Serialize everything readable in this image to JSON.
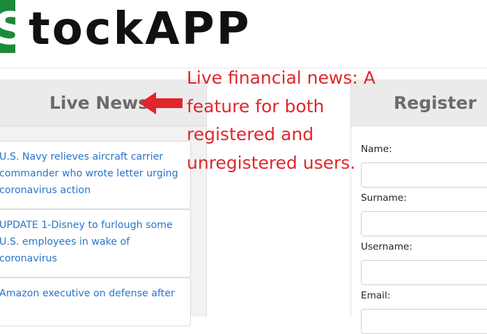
{
  "logo": {
    "text_s": "S",
    "text_rest": "tockAPP"
  },
  "news": {
    "title": "Live News",
    "items": [
      "U.S. Navy relieves aircraft carrier commander who wrote letter urging coronavirus action",
      "UPDATE 1-Disney to furlough some U.S. employees in wake of coronavirus",
      "Amazon executive on defense after"
    ]
  },
  "register": {
    "title": "Register",
    "fields": [
      {
        "label": "Name:"
      },
      {
        "label": "Surname:"
      },
      {
        "label": "Username:"
      },
      {
        "label": "Email:"
      }
    ]
  },
  "annotation": {
    "text": "Live financial news: A\nfeature for both\nregistered and\nunregistered users.",
    "color": "#e0262c"
  }
}
